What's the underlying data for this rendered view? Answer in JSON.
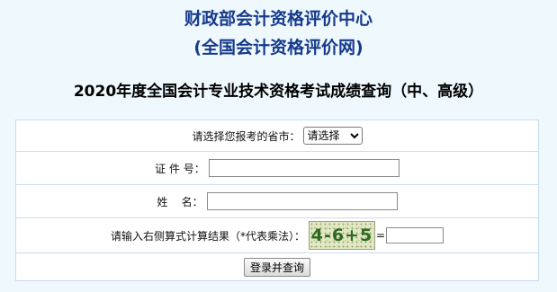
{
  "header": {
    "org_name": "财政部会计资格评价中心",
    "site_name": "(全国会计资格评价网)"
  },
  "page_title": "2020年度全国会计专业技术资格考试成绩查询（中、高级）",
  "form": {
    "province_label": "请选择您报考的省市：",
    "province_selected": "请选择",
    "id_label": "证 件 号：",
    "id_value": "",
    "name_label": "姓    名：",
    "name_value": "",
    "captcha_label": "请输入右侧算式计算结果（*代表乘法）：",
    "captcha_text": "4-6+5",
    "equals": "=",
    "captcha_answer": "",
    "submit_label": "登录并查询"
  },
  "colors": {
    "page_background": "#eef8fd",
    "header_text": "#163a8c",
    "table_border": "#c8dcef",
    "captcha_text": "#2e6b1f"
  }
}
